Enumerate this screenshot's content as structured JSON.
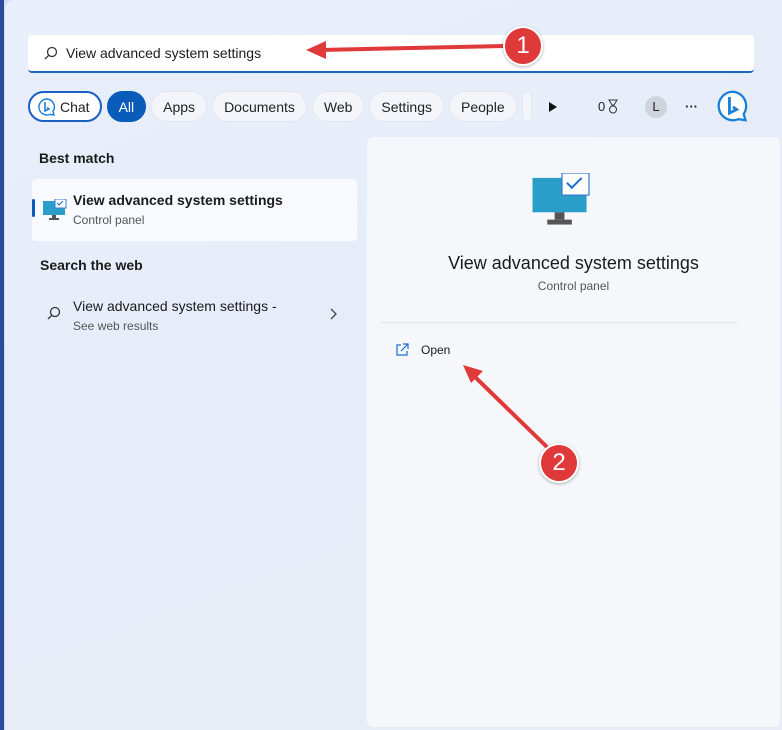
{
  "search": {
    "value": "View advanced system settings"
  },
  "filters": {
    "chat": "Chat",
    "all": "All",
    "apps": "Apps",
    "documents": "Documents",
    "web": "Web",
    "settings": "Settings",
    "people": "People"
  },
  "rewards": {
    "count": "0"
  },
  "avatar": {
    "initial": "L"
  },
  "more": "···",
  "left": {
    "best_match_heading": "Best match",
    "best_match": {
      "title": "View advanced system settings",
      "subtitle": "Control panel"
    },
    "web_heading": "Search the web",
    "web_result": {
      "title": "View advanced system settings -",
      "subtitle": "See web results"
    }
  },
  "preview": {
    "title": "View advanced system settings",
    "subtitle": "Control panel",
    "open_label": "Open"
  },
  "annotations": {
    "step1": "1",
    "step2": "2"
  },
  "colors": {
    "accent": "#0a5cba",
    "annotation": "#e0393a"
  }
}
